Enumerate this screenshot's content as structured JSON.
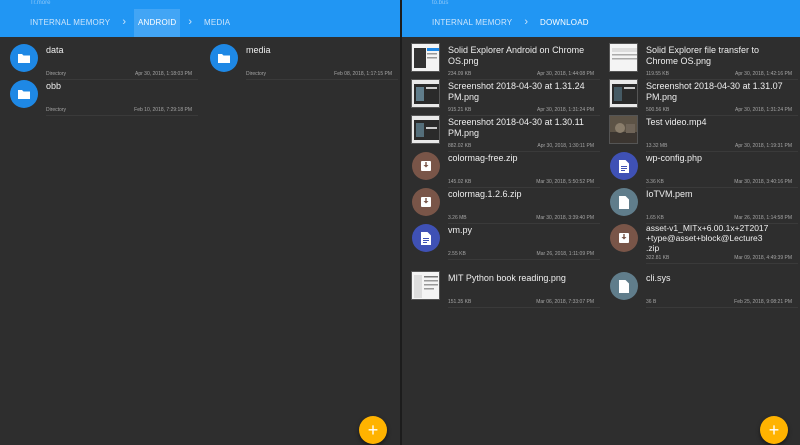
{
  "colors": {
    "header": "#2196f3",
    "background": "#2e2e2e",
    "folder": "#1e88e5",
    "archive": "#795548",
    "code": "#3f51b5",
    "generic": "#607d8b",
    "fab": "#ffb300"
  },
  "left_pane": {
    "subline": "Tr.more",
    "breadcrumbs": [
      "INTERNAL MEMORY",
      "ANDROID",
      "MEDIA"
    ],
    "active_crumb": "ANDROID",
    "items": [
      {
        "name": "data",
        "meta": "Directory",
        "date": "Apr 30, 2018, 1:18:03 PM",
        "icon": "folder-icon"
      },
      {
        "name": "media",
        "meta": "Directory",
        "date": "Feb 08, 2018, 1:17:15 PM",
        "icon": "folder-icon"
      },
      {
        "name": "obb",
        "meta": "Directory",
        "date": "Feb 10, 2018, 7:29:18 PM",
        "icon": "folder-icon"
      }
    ]
  },
  "right_pane": {
    "subline": "to.bus",
    "breadcrumbs": [
      "INTERNAL MEMORY",
      "DOWNLOAD"
    ],
    "active_crumb": "DOWNLOAD",
    "items": [
      {
        "name": "Solid Explorer Android on Chrome OS.png",
        "meta": "234.09 KB",
        "date": "Apr 30, 2018, 1:44:08 PM",
        "icon": "image-thumbnail"
      },
      {
        "name": "Solid Explorer file transfer to Chrome OS.png",
        "meta": "119.55 KB",
        "date": "Apr 30, 2018, 1:42:16 PM",
        "icon": "image-thumbnail"
      },
      {
        "name": "Screenshot 2018-04-30 at 1.31.24 PM.png",
        "meta": "915.21 KB",
        "date": "Apr 30, 2018, 1:31:24 PM",
        "icon": "image-thumbnail"
      },
      {
        "name": "Screenshot 2018-04-30 at 1.31.07 PM.png",
        "meta": "500.56 KB",
        "date": "Apr 30, 2018, 1:31:24 PM",
        "icon": "image-thumbnail"
      },
      {
        "name": "Screenshot 2018-04-30 at 1.30.11 PM.png",
        "meta": "882.02 KB",
        "date": "Apr 30, 2018, 1:30:11 PM",
        "icon": "image-thumbnail"
      },
      {
        "name": "Test video.mp4",
        "meta": "13.32 MB",
        "date": "Apr 30, 2018, 1:19:31 PM",
        "icon": "video-thumbnail"
      },
      {
        "name": "colormag-free.zip",
        "meta": "145.02 KB",
        "date": "Mar 30, 2018, 5:50:52 PM",
        "icon": "archive-icon"
      },
      {
        "name": "wp-config.php",
        "meta": "3.36 KB",
        "date": "Mar 30, 2018, 3:40:16 PM",
        "icon": "code-file-icon"
      },
      {
        "name": "colormag.1.2.6.zip",
        "meta": "3.26 MB",
        "date": "Mar 30, 2018, 3:39:40 PM",
        "icon": "archive-icon"
      },
      {
        "name": "IoTVM.pem",
        "meta": "1.65 KB",
        "date": "Mar 26, 2018, 1:14:58 PM",
        "icon": "file-icon"
      },
      {
        "name": "vm.py",
        "meta": "2.55 KB",
        "date": "Mar 26, 2018, 1:11:09 PM",
        "icon": "code-file-icon"
      },
      {
        "name": "asset-v1_MITx+6.00.1x+2T2017\n+type@asset+block@Lecture3\n.zip",
        "meta": "322.81 KB",
        "date": "Mar 09, 2018, 4:49:39 PM",
        "icon": "archive-icon"
      },
      {
        "name": "MIT Python book reading.png",
        "meta": "151.35 KB",
        "date": "Mar 06, 2018, 7:33:07 PM",
        "icon": "image-thumbnail"
      },
      {
        "name": "cli.sys",
        "meta": "36 B",
        "date": "Feb 25, 2018, 9:08:21 PM",
        "icon": "file-icon"
      }
    ]
  },
  "fab_label": "+"
}
